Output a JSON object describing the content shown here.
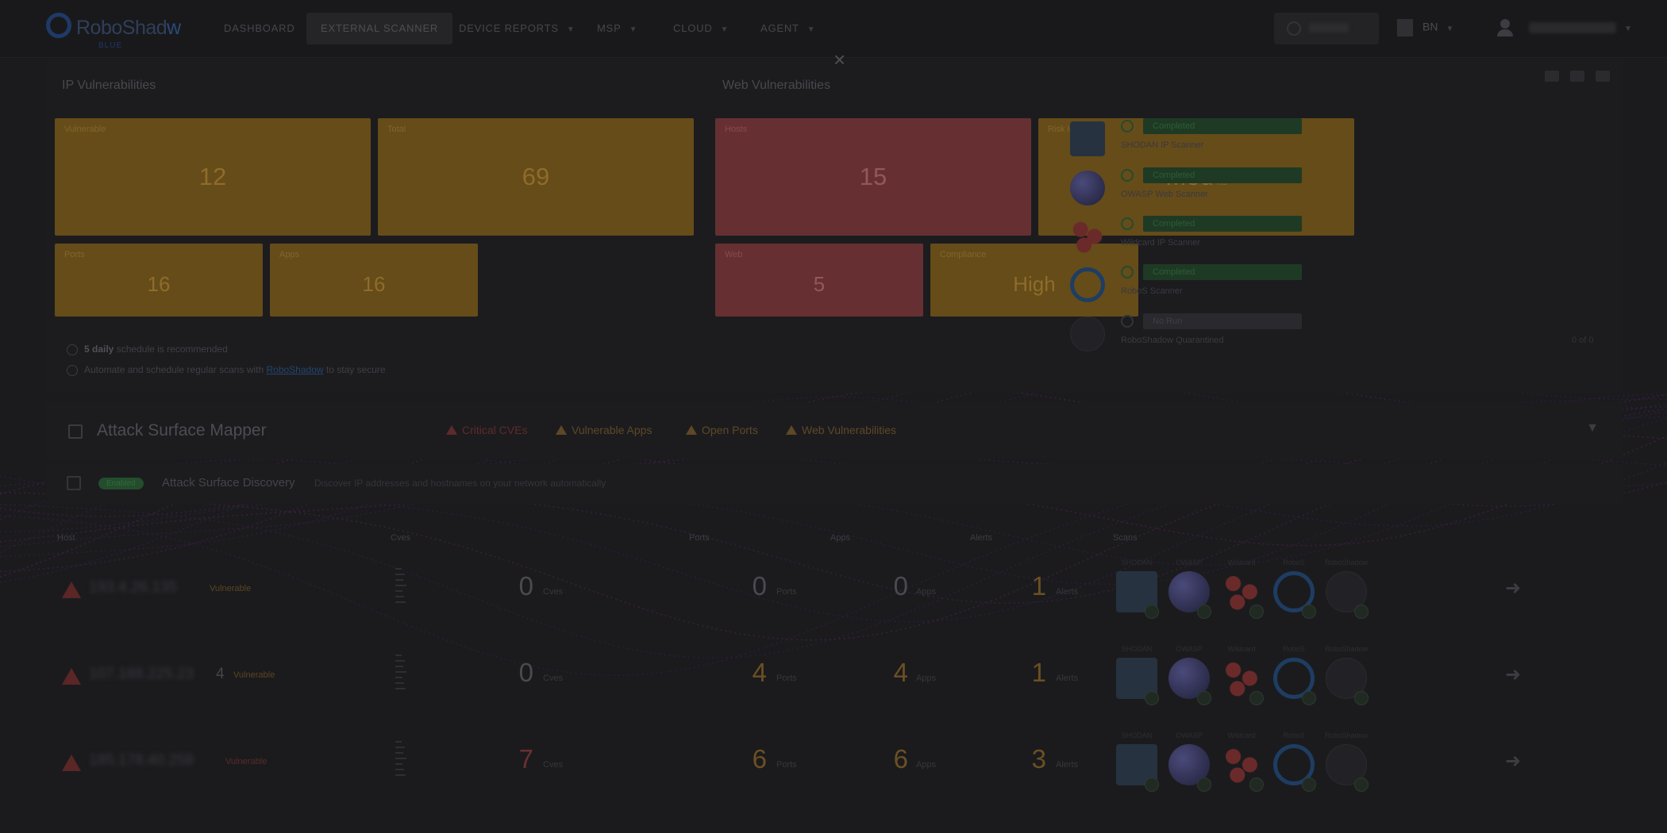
{
  "nav": {
    "logo_text_a": "RoboShad",
    "logo_text_b": "w",
    "logo_sub": "BLUE",
    "items": [
      {
        "label": "Dashboard",
        "dropdown": false
      },
      {
        "label": "External Scanner",
        "dropdown": false,
        "active": true
      },
      {
        "label": "Device Reports",
        "dropdown": true
      },
      {
        "label": "MSP",
        "dropdown": true
      },
      {
        "label": "Cloud",
        "dropdown": true
      },
      {
        "label": "Agent",
        "dropdown": true
      }
    ],
    "org_label": "BN"
  },
  "close_label": "×",
  "ip_vulnerabilities": {
    "title": "IP Vulnerabilities",
    "tiles": [
      {
        "label": "Vulnerable",
        "value": "12"
      },
      {
        "label": "Total",
        "value": "69"
      },
      {
        "label": "Ports",
        "value": "16"
      },
      {
        "label": "Apps",
        "value": "16"
      }
    ]
  },
  "web_vulnerabilities": {
    "title": "Web Vulnerabilities",
    "tiles": [
      {
        "label": "Hosts",
        "value": "15"
      },
      {
        "label": "Risk level",
        "value": "Med",
        "suffix": "ns"
      },
      {
        "label": "Web",
        "value": "5"
      },
      {
        "label": "Compliance",
        "value": "High"
      }
    ]
  },
  "notes": {
    "line1_count": "5 daily",
    "line1_rest": "schedule is recommended",
    "line2_pre": "Automate and schedule regular scans with",
    "line2_link": "RoboShadow",
    "line2_post": "to stay secure"
  },
  "scanners": [
    {
      "status": "Completed",
      "name": "SHODAN IP Scanner",
      "icon": "shodan-icon"
    },
    {
      "status": "Completed",
      "name": "OWASP Web Scanner",
      "icon": "globe-icon"
    },
    {
      "status": "Completed",
      "name": "Wildcard IP Scanner",
      "icon": "dots-icon"
    },
    {
      "status": "Completed",
      "name": "RoboS Scanner",
      "icon": "ring-icon"
    },
    {
      "status": "No Run",
      "name": "RoboShadow Quarantined",
      "icon": "dark-icon",
      "extra": "0 of 0"
    }
  ],
  "asm": {
    "title": "Attack Surface Mapper",
    "tags": [
      "Critical CVEs",
      "Vulnerable Apps",
      "Open Ports",
      "Web Vulnerabilities"
    ]
  },
  "discovery": {
    "badge": "Enabled",
    "title": "Attack Surface Discovery",
    "description": "Discover IP addresses and hostnames on your network automatically"
  },
  "table": {
    "headers": [
      "Host",
      "Cves",
      "Ports",
      "Apps",
      "Alerts",
      "Scans"
    ],
    "units": {
      "cves": "Cves",
      "ports": "Ports",
      "apps": "Apps",
      "alerts": "Alerts"
    },
    "scan_captions": [
      "SHODAN",
      "OWASP",
      "Wildcard",
      "RoboS",
      "RoboShadow"
    ],
    "rows": [
      {
        "host": "193.4.26.135",
        "host_end": "",
        "tag": "Vulnerable",
        "tag_color": "orange",
        "cves": "0",
        "ports": "0",
        "apps": "0",
        "alerts": "1",
        "cves_level": "none",
        "ports_level": "none",
        "apps_level": "none",
        "alerts_level": "warn"
      },
      {
        "host": "107.188.225.23",
        "host_end": "4",
        "tag": "Vulnerable",
        "tag_color": "orange",
        "cves": "0",
        "ports": "4",
        "apps": "4",
        "alerts": "1",
        "cves_level": "none",
        "ports_level": "warn",
        "apps_level": "warn",
        "alerts_level": "warn"
      },
      {
        "host": "185.178.40.258",
        "host_end": "",
        "tag": "Vulnerable",
        "tag_color": "red",
        "cves": "7",
        "ports": "6",
        "apps": "6",
        "alerts": "3",
        "cves_level": "crit",
        "ports_level": "warn",
        "apps_level": "warn",
        "alerts_level": "warn"
      }
    ]
  }
}
